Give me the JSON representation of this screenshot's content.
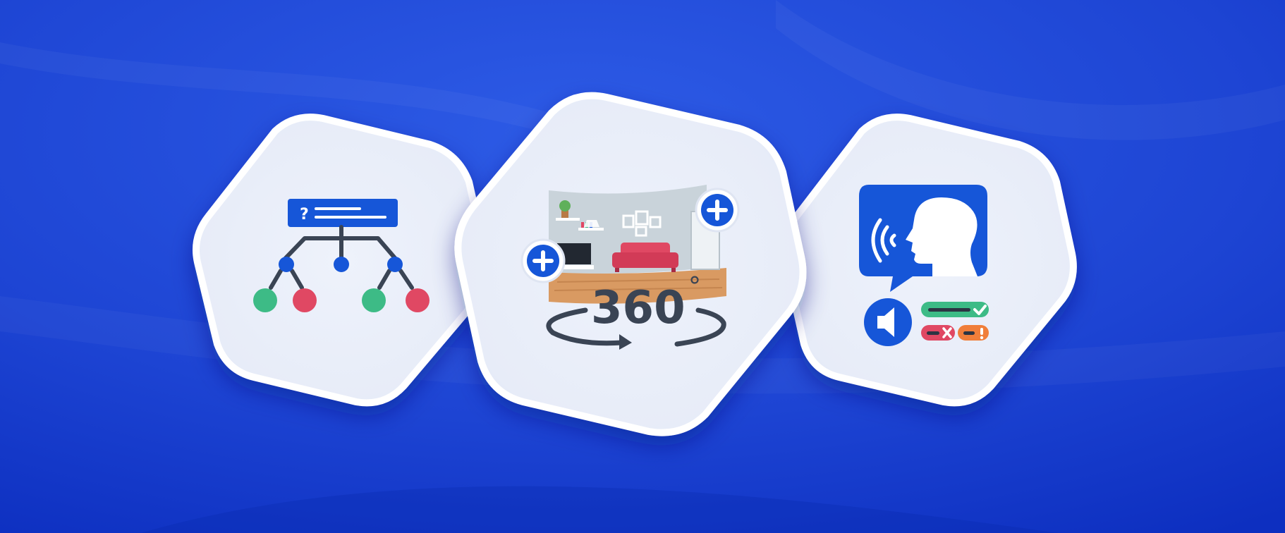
{
  "theme": {
    "background_top": "#2a55e3",
    "background_bottom": "#0b2fc4",
    "card_fill": "#e9eef9",
    "card_border": "#ffffff",
    "primary_blue": "#1656d8",
    "green": "#3dbb86",
    "red": "#e04863",
    "orange": "#f07e3a",
    "dark": "#3a4454"
  },
  "cards": [
    {
      "label": "branching-scenario",
      "icon": "decision-tree-icon"
    },
    {
      "label": "360-virtual-tour",
      "icon": "panorama-360-icon"
    },
    {
      "label": "voice-interaction",
      "icon": "speech-recognition-icon"
    }
  ],
  "tree": {
    "question_mark": "?"
  },
  "panorama": {
    "number": "360",
    "degree": "°",
    "hotspot_left": "plus-icon",
    "hotspot_right": "plus-icon"
  },
  "voice": {
    "speaker_icon": "speaker-icon",
    "feedback": [
      "check-icon",
      "x-icon",
      "exclamation-icon"
    ]
  }
}
